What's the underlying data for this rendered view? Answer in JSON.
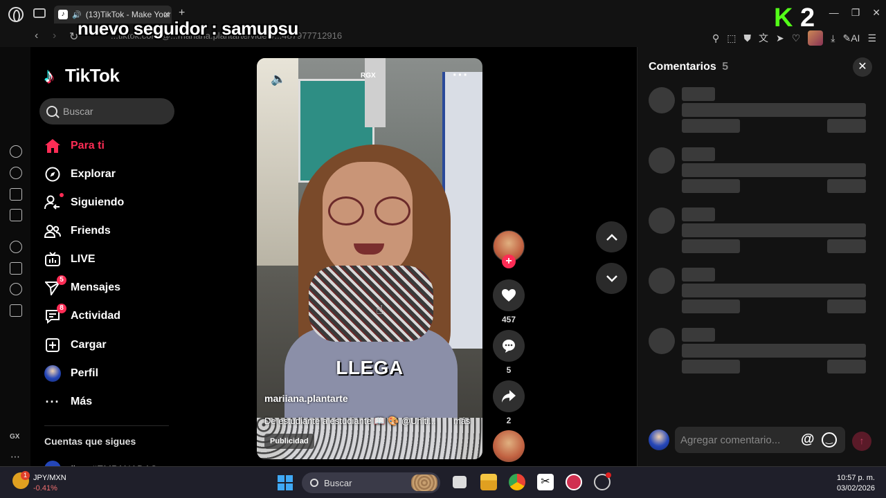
{
  "browser": {
    "tab_title": "(13)TikTok - Make Your",
    "url": "...tiktok.com/@...mariana.plantarte/video/...487977712916",
    "window_controls": [
      "minimize-icon",
      "maximize-icon",
      "close-icon"
    ],
    "k2_logo": {
      "k": "K",
      "two": "2"
    }
  },
  "stream_overlay": {
    "text": "nuevo seguidor : samupsu"
  },
  "tiktok_nav": {
    "logo_text": "TikTok",
    "search_placeholder": "Buscar",
    "items": [
      {
        "label": "Para ti",
        "icon": "home-icon",
        "active": true
      },
      {
        "label": "Explorar",
        "icon": "compass-icon"
      },
      {
        "label": "Siguiendo",
        "icon": "following-icon"
      },
      {
        "label": "Friends",
        "icon": "friends-icon"
      },
      {
        "label": "LIVE",
        "icon": "live-icon"
      },
      {
        "label": "Mensajes",
        "icon": "messages-icon",
        "badge": "5"
      },
      {
        "label": "Actividad",
        "icon": "activity-icon",
        "badge": "8"
      },
      {
        "label": "Cargar",
        "icon": "upload-icon"
      },
      {
        "label": "Perfil",
        "icon": "profile-avatar"
      },
      {
        "label": "Más",
        "icon": "more-icon"
      }
    ],
    "following_title": "Cuentas que sigues",
    "following_first": "dimo #EMPANADAS"
  },
  "video": {
    "watermark": "RGX",
    "caption": "LLEGA",
    "username": "mariiana.plantarte",
    "description": "De estudiante a estudiante 📖 🎨 @Uniti...",
    "more_label": "más",
    "ad_label": "Publicidad"
  },
  "actions": {
    "likes": "457",
    "comments": "5",
    "shares": "2"
  },
  "comments_panel": {
    "title": "Comentarios",
    "count": "5",
    "input_placeholder": "Agregar comentario...",
    "at_symbol": "@"
  },
  "taskbar": {
    "currency_pair": "JPY/MXN",
    "currency_change": "-0.41%",
    "currency_badge": "1",
    "search_label": "Buscar",
    "time": "10:57 p. m.",
    "date": "03/02/2026"
  },
  "opera_sidebar": {
    "gx_label": "GX"
  },
  "colors": {
    "tiktok_red": "#fe2c55",
    "kick_green": "#53fc18",
    "panel_bg": "#121212",
    "skeleton": "#3a3a3a"
  }
}
